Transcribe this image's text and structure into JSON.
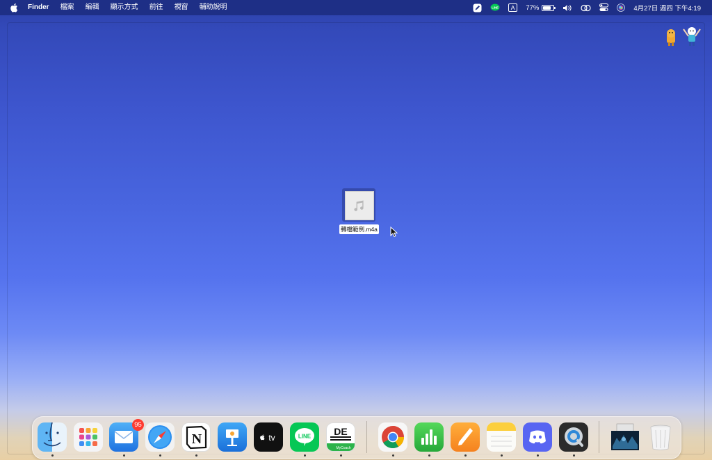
{
  "menubar": {
    "app_name": "Finder",
    "menus": [
      "檔案",
      "編輯",
      "顯示方式",
      "前往",
      "視窗",
      "輔助說明"
    ],
    "status": {
      "input_method": "A",
      "battery_percent": "77%",
      "battery_level": 0.77,
      "datetime": "4月27日 週四 下午4:19",
      "line_tray_label": "LINE"
    }
  },
  "desktop": {
    "file": {
      "name": "轉檔範例.m4a",
      "icon": "audio-file-icon"
    }
  },
  "dock": {
    "apps": [
      {
        "name": "Finder",
        "icon": "finder-icon",
        "running": true
      },
      {
        "name": "Launchpad",
        "icon": "launchpad-icon",
        "running": false
      },
      {
        "name": "Mail",
        "icon": "mail-icon",
        "running": true,
        "badge": "95"
      },
      {
        "name": "Safari",
        "icon": "safari-icon",
        "running": true
      },
      {
        "name": "Notion",
        "icon": "notion-icon",
        "running": true
      },
      {
        "name": "Keynote",
        "icon": "keynote-icon",
        "running": false
      },
      {
        "name": "TV",
        "icon": "apple-tv-icon",
        "running": false
      },
      {
        "name": "LINE",
        "icon": "line-icon",
        "running": true
      },
      {
        "name": "MyCoach",
        "icon": "mycoach-icon",
        "running": true
      },
      {
        "name": "Google Chrome",
        "icon": "chrome-icon",
        "running": true
      },
      {
        "name": "Numbers",
        "icon": "numbers-icon",
        "running": true
      },
      {
        "name": "Pages",
        "icon": "pages-icon",
        "running": true
      },
      {
        "name": "Notes",
        "icon": "notes-icon",
        "running": true
      },
      {
        "name": "Discord",
        "icon": "discord-icon",
        "running": true
      },
      {
        "name": "QuickTime Player",
        "icon": "quicktime-icon",
        "running": true
      }
    ],
    "app_icon_texts": {
      "tv": "tv",
      "line": "LINE",
      "mycoach_top": "DE",
      "mycoach_bottom": "MyCoach",
      "notion": "N"
    },
    "trailing": [
      {
        "name": "Downloads stack",
        "icon": "downloads-stack-icon"
      },
      {
        "name": "Trash",
        "icon": "trash-icon"
      }
    ]
  },
  "colors": {
    "menubar_bg": "#1e2f86",
    "badge_red": "#ff3b30",
    "line_green": "#06c755"
  }
}
